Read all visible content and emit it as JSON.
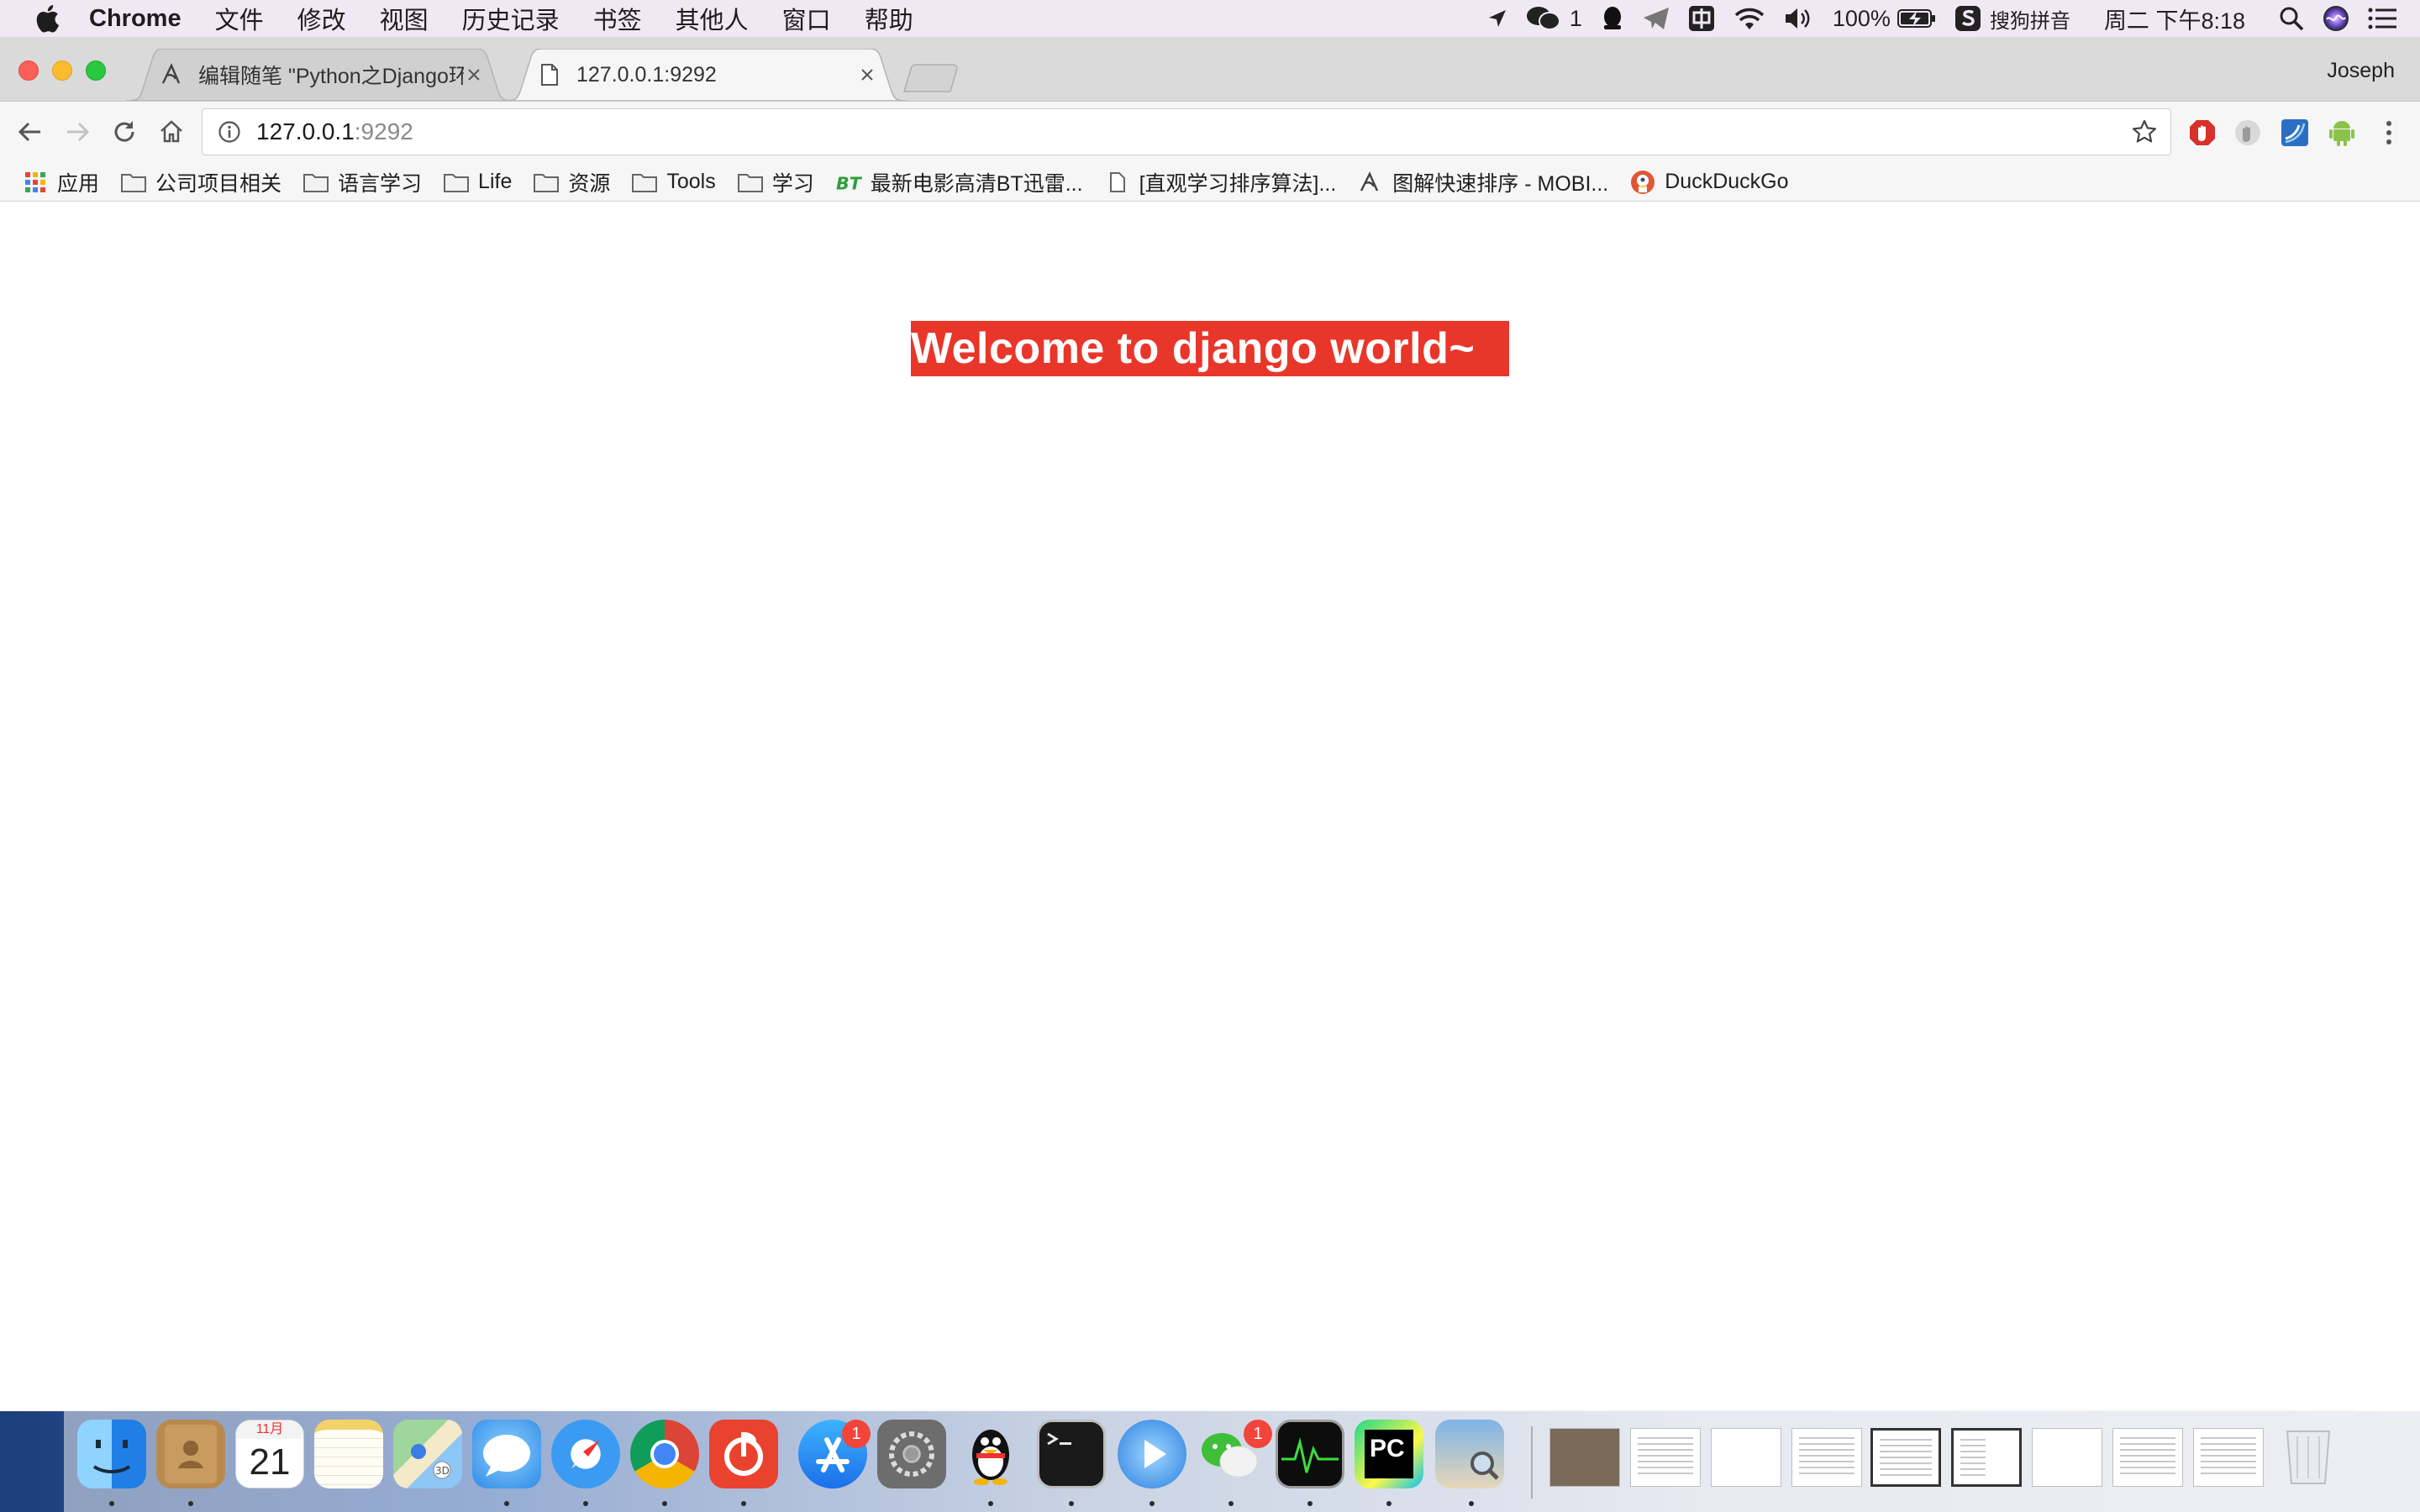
{
  "menubar": {
    "app_name": "Chrome",
    "menus": [
      "文件",
      "修改",
      "视图",
      "历史记录",
      "书签",
      "其他人",
      "窗口",
      "帮助"
    ],
    "wechat_count": "1",
    "battery": "100%",
    "input_method": "搜狗拼音",
    "clock": "周二 下午8:18"
  },
  "browser": {
    "profile": "Joseph",
    "tabs": [
      {
        "title": "编辑随笔 \"Python之Django环境",
        "active": false
      },
      {
        "title": "127.0.0.1:9292",
        "active": true
      }
    ],
    "address": {
      "host": "127.0.0.1",
      "port": ":9292"
    },
    "bookmarks": [
      {
        "label": "应用",
        "icon": "apps-grid-icon"
      },
      {
        "label": "公司项目相关",
        "icon": "folder-icon"
      },
      {
        "label": "语言学习",
        "icon": "folder-icon"
      },
      {
        "label": "Life",
        "icon": "folder-icon"
      },
      {
        "label": "资源",
        "icon": "folder-icon"
      },
      {
        "label": "Tools",
        "icon": "folder-icon"
      },
      {
        "label": "学习",
        "icon": "folder-icon"
      },
      {
        "label": "最新电影高清BT迅雷...",
        "icon": "bt-site-icon"
      },
      {
        "label": "[直观学习排序算法]...",
        "icon": "page-icon"
      },
      {
        "label": "图解快速排序 - MOBI...",
        "icon": "blog-icon"
      },
      {
        "label": "DuckDuckGo",
        "icon": "duckduckgo-icon"
      }
    ]
  },
  "page": {
    "heading": "Welcome to django world~",
    "heading_bg": "#e9362a"
  },
  "dock": {
    "calendar_month": "11月",
    "calendar_day": "21",
    "appstore_badge": "1",
    "wechat_badge": "1",
    "pycharm_label": "PC"
  }
}
